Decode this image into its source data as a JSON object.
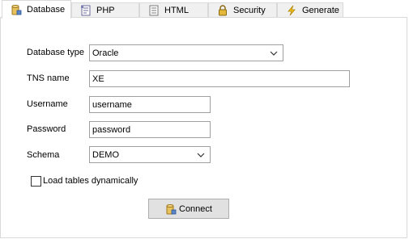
{
  "tabs": [
    {
      "label": "Database",
      "icon": "database-icon",
      "active": true
    },
    {
      "label": "PHP",
      "icon": "php-icon",
      "active": false
    },
    {
      "label": "HTML",
      "icon": "html-icon",
      "active": false
    },
    {
      "label": "Security",
      "icon": "lock-icon",
      "active": false
    },
    {
      "label": "Generate",
      "icon": "lightning-icon",
      "active": false
    }
  ],
  "form": {
    "db_type_label": "Database type",
    "db_type_value": "Oracle",
    "tns_label": "TNS name",
    "tns_value": "XE",
    "username_label": "Username",
    "username_value": "username",
    "password_label": "Password",
    "password_value": "password",
    "schema_label": "Schema",
    "schema_value": "DEMO",
    "load_tables_label": "Load tables dynamically",
    "load_tables_checked": false,
    "connect_label": "Connect"
  },
  "colors": {
    "tab_inactive_bg": "#f0f0f0",
    "border": "#d9d9d9",
    "button_bg": "#e1e1e1"
  }
}
